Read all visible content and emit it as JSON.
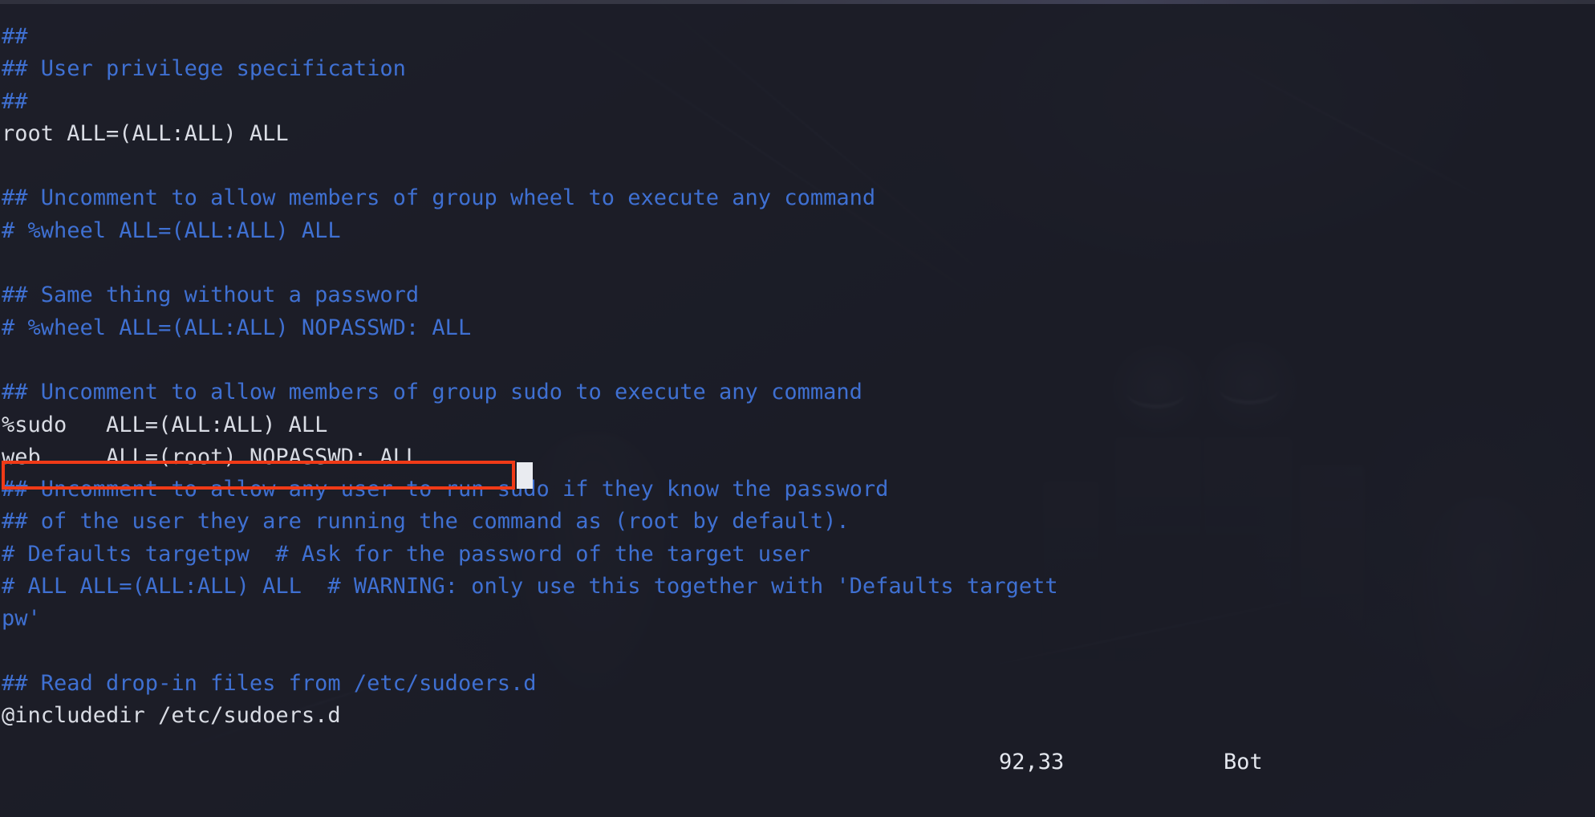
{
  "terminal": {
    "editor": "vim",
    "file": "/etc/sudoers",
    "background_color": "#22232e",
    "comment_color": "#3f70d2",
    "code_color": "#d9dce4",
    "cursor_color": "#e9ebf0",
    "annotation_color": "#f03a17"
  },
  "lines": [
    {
      "text": "##",
      "kind": "comment"
    },
    {
      "text": "## User privilege specification",
      "kind": "comment"
    },
    {
      "text": "##",
      "kind": "comment"
    },
    {
      "text": "root ALL=(ALL:ALL) ALL",
      "kind": "code"
    },
    {
      "text": "",
      "kind": "blank"
    },
    {
      "text": "## Uncomment to allow members of group wheel to execute any command",
      "kind": "comment"
    },
    {
      "text": "# %wheel ALL=(ALL:ALL) ALL",
      "kind": "comment"
    },
    {
      "text": "",
      "kind": "blank"
    },
    {
      "text": "## Same thing without a password",
      "kind": "comment"
    },
    {
      "text": "# %wheel ALL=(ALL:ALL) NOPASSWD: ALL",
      "kind": "comment"
    },
    {
      "text": "",
      "kind": "blank"
    },
    {
      "text": "## Uncomment to allow members of group sudo to execute any command",
      "kind": "comment"
    },
    {
      "text": "%sudo   ALL=(ALL:ALL) ALL",
      "kind": "code"
    },
    {
      "text": "web     ALL=(root) NOPASSWD: ALL",
      "kind": "code"
    },
    {
      "text": "## Uncomment to allow any user to run sudo if they know the password",
      "kind": "comment"
    },
    {
      "text": "## of the user they are running the command as (root by default).",
      "kind": "comment"
    },
    {
      "text": "# Defaults targetpw  # Ask for the password of the target user",
      "kind": "comment"
    },
    {
      "text": "# ALL ALL=(ALL:ALL) ALL  # WARNING: only use this together with 'Defaults targett",
      "kind": "comment"
    },
    {
      "text": "pw'",
      "kind": "comment"
    },
    {
      "text": "",
      "kind": "blank"
    },
    {
      "text": "## Read drop-in files from /etc/sudoers.d",
      "kind": "comment"
    },
    {
      "text": "@includedir /etc/sudoers.d",
      "kind": "code"
    }
  ],
  "annotated": {
    "line_index": 13,
    "text": "web     ALL=(root) NOPASSWD: ALL",
    "description": "red-rectangle highlight around the added sudoers rule"
  },
  "cursor": {
    "glyph": " ",
    "shape": "block"
  },
  "statusline": {
    "ruler": "92,33",
    "position": "Bot"
  }
}
